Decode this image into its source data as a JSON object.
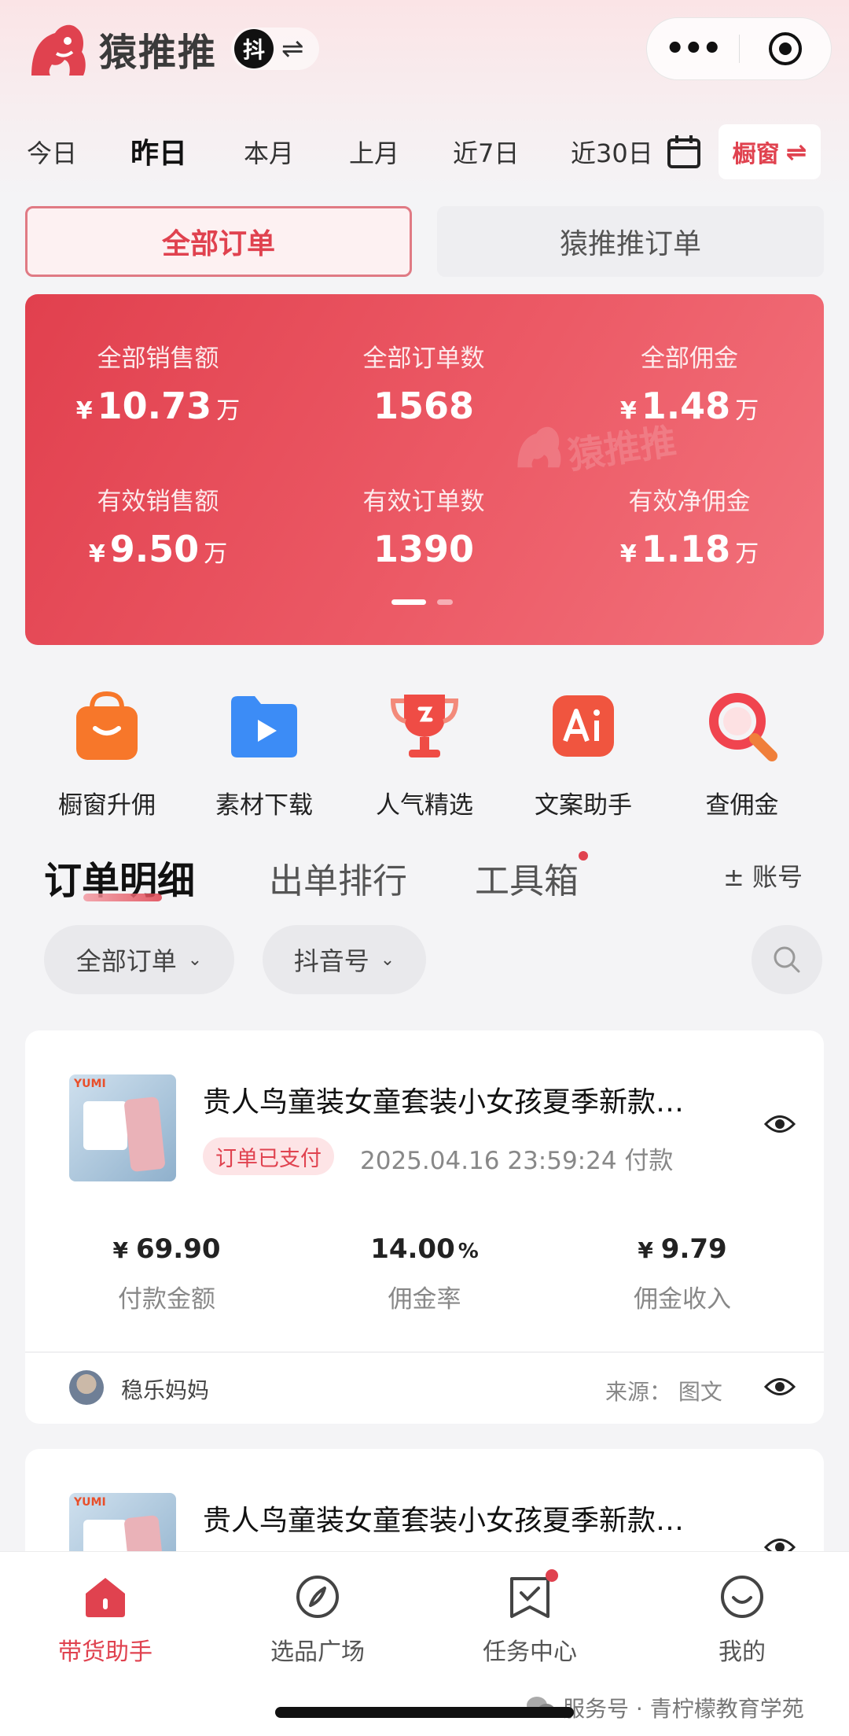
{
  "app": {
    "name": "猿推推",
    "platform_badge": "抖",
    "swap_glyph": "⇌"
  },
  "capsule": {
    "more": "•••"
  },
  "date_tabs": [
    {
      "label": "今日",
      "active": false
    },
    {
      "label": "昨日",
      "active": true
    },
    {
      "label": "本月",
      "active": false
    },
    {
      "label": "上月",
      "active": false
    },
    {
      "label": "近7日",
      "active": false
    },
    {
      "label": "近30日",
      "active": false
    }
  ],
  "window_button": {
    "label": "橱窗",
    "swap": "⇌"
  },
  "order_tabs": {
    "all": "全部订单",
    "ytt": "猿推推订单"
  },
  "stats": {
    "watermark": "猿推推",
    "items": [
      {
        "label": "全部销售额",
        "prefix": "¥",
        "value": "10.73",
        "unit": "万"
      },
      {
        "label": "全部订单数",
        "prefix": "",
        "value": "1568",
        "unit": ""
      },
      {
        "label": "全部佣金",
        "prefix": "¥",
        "value": "1.48",
        "unit": "万"
      },
      {
        "label": "有效销售额",
        "prefix": "¥",
        "value": "9.50",
        "unit": "万"
      },
      {
        "label": "有效订单数",
        "prefix": "",
        "value": "1390",
        "unit": ""
      },
      {
        "label": "有效净佣金",
        "prefix": "¥",
        "value": "1.18",
        "unit": "万"
      }
    ],
    "page_indicator": {
      "current": 1,
      "total": 2
    }
  },
  "tools": [
    {
      "label": "橱窗升佣",
      "icon": "shopping-bag-icon",
      "color": "#f7772a"
    },
    {
      "label": "素材下载",
      "icon": "video-folder-icon",
      "color": "#3c8cf6"
    },
    {
      "label": "人气精选",
      "icon": "trophy-icon",
      "color": "#ef4c45"
    },
    {
      "label": "文案助手",
      "icon": "ai-icon",
      "color": "#f0553f"
    },
    {
      "label": "查佣金",
      "icon": "magnifier-icon",
      "color": "#f0444f"
    }
  ],
  "section_tabs": {
    "items": [
      {
        "label": "订单明细",
        "active": true
      },
      {
        "label": "出单排行",
        "active": false
      },
      {
        "label": "工具箱",
        "active": false,
        "dot": true
      }
    ],
    "account": "± 账号"
  },
  "filters": {
    "order_type": "全部订单",
    "account_type": "抖音号"
  },
  "orders": [
    {
      "brand": "YUMI",
      "title": "贵人鸟童装女童套装小女孩夏季新款…",
      "status": "订单已支付",
      "pay_time": "2025.04.16 23:59:24 付款",
      "metrics": [
        {
          "label": "付款金额",
          "value": "69.90",
          "prefix": "¥",
          "suffix": ""
        },
        {
          "label": "佣金率",
          "value": "14.00",
          "prefix": "",
          "suffix": "%"
        },
        {
          "label": "佣金收入",
          "value": "9.79",
          "prefix": "¥",
          "suffix": ""
        }
      ],
      "user": "稳乐妈妈",
      "source": "来源：  图文"
    },
    {
      "brand": "YUMI",
      "title": "贵人鸟童装女童套装小女孩夏季新款…"
    }
  ],
  "bottom_nav": [
    {
      "label": "带货助手",
      "icon": "home-icon",
      "active": true
    },
    {
      "label": "选品广场",
      "icon": "compass-icon",
      "active": false
    },
    {
      "label": "任务中心",
      "icon": "task-icon",
      "active": false,
      "dot": true
    },
    {
      "label": "我的",
      "icon": "smile-icon",
      "active": false
    }
  ],
  "footer_note": "服务号 · 青柠檬教育学苑",
  "colors": {
    "accent": "#e0424f",
    "card_start": "#e1404e",
    "card_end": "#f2727c"
  }
}
